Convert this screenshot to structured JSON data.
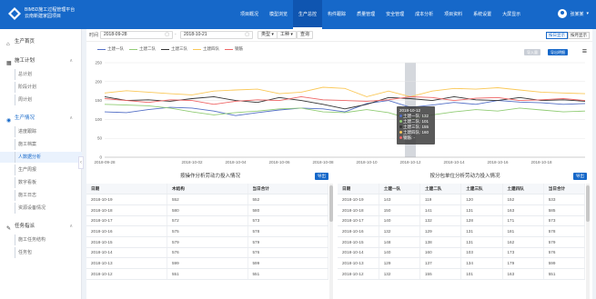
{
  "brand": {
    "line1": "BIM5D施工过程管理平台",
    "line2": "云南新建家园项目"
  },
  "nav": [
    {
      "label": "项目概况"
    },
    {
      "label": "模型浏览"
    },
    {
      "label": "生产总控",
      "active": true
    },
    {
      "label": "构件跟踪"
    },
    {
      "label": "质量管理"
    },
    {
      "label": "安全管理"
    },
    {
      "label": "成本分析"
    },
    {
      "label": "项目资料"
    },
    {
      "label": "系统设置"
    },
    {
      "label": "大屏显示"
    }
  ],
  "user": {
    "name": "张某某"
  },
  "sidebar": [
    {
      "label": "生产首页",
      "type": "main",
      "icon": "⌂",
      "iconName": "home-icon"
    },
    {
      "label": "施工计划",
      "type": "main",
      "icon": "▦",
      "iconName": "calendar-icon",
      "chev": "∧"
    },
    {
      "label": "总计划",
      "type": "sub"
    },
    {
      "label": "阶段计划",
      "type": "sub"
    },
    {
      "label": "周计划",
      "type": "sub"
    },
    {
      "label": "生产情况",
      "type": "main",
      "icon": "◉",
      "iconName": "production-icon",
      "chev": "∧",
      "blue": true
    },
    {
      "label": "进度跟踪",
      "type": "sub"
    },
    {
      "label": "施工档案",
      "type": "sub"
    },
    {
      "label": "人数据分析",
      "type": "sub",
      "active": true
    },
    {
      "label": "生产周报",
      "type": "sub"
    },
    {
      "label": "数字看板",
      "type": "sub"
    },
    {
      "label": "施工日志",
      "type": "sub"
    },
    {
      "label": "资源设备情况",
      "type": "sub"
    },
    {
      "label": "任务指派",
      "type": "main",
      "icon": "✎",
      "iconName": "task-icon",
      "chev": "∧"
    },
    {
      "label": "施工任务结构",
      "type": "sub"
    },
    {
      "label": "任务包",
      "type": "sub"
    }
  ],
  "filters": {
    "period_label": "时间",
    "start": "2018-09-28",
    "end": "2018-10-21",
    "type_select": "类型 ▾",
    "worker_select": "工种 ▾",
    "query": "查询",
    "toggle_a": "按日显示",
    "toggle_b": "按月显示"
  },
  "chart_data": {
    "type": "line",
    "x": [
      "2018-09-28",
      "2018-09-29",
      "2018-09-30",
      "2018-10-01",
      "2018-10-02",
      "2018-10-03",
      "2018-10-04",
      "2018-10-05",
      "2018-10-06",
      "2018-10-07",
      "2018-10-08",
      "2018-10-09",
      "2018-10-10",
      "2018-10-11",
      "2018-10-12",
      "2018-10-13",
      "2018-10-14",
      "2018-10-15",
      "2018-10-16",
      "2018-10-17",
      "2018-10-18",
      "2018-10-19",
      "2018-10-20"
    ],
    "xticks": [
      "2018-09-28",
      "2018-10-02",
      "2018-10-04",
      "2018-10-06",
      "2018-10-08",
      "2018-10-10",
      "2018-10-12",
      "2018-10-14",
      "2018-10-16",
      "2018-10-18"
    ],
    "yticks": [
      0,
      50,
      100,
      150,
      200,
      250
    ],
    "ylim": [
      0,
      250
    ],
    "series": [
      {
        "name": "土建一队",
        "color": "#5470c6",
        "values": [
          120,
          118,
          126,
          132,
          130,
          122,
          110,
          118,
          125,
          130,
          128,
          120,
          142,
          150,
          132,
          138,
          145,
          140,
          150,
          146,
          144,
          140,
          142
        ]
      },
      {
        "name": "土建二队",
        "color": "#91cc75",
        "values": [
          140,
          138,
          136,
          130,
          120,
          112,
          118,
          122,
          128,
          130,
          120,
          118,
          126,
          118,
          101,
          112,
          120,
          126,
          122,
          130,
          125,
          120,
          122
        ]
      },
      {
        "name": "土建三队",
        "color": "#333333",
        "values": [
          160,
          150,
          152,
          148,
          155,
          160,
          150,
          145,
          158,
          150,
          140,
          128,
          140,
          158,
          155,
          150,
          160,
          152,
          150,
          158,
          150,
          152,
          148
        ]
      },
      {
        "name": "土建四队",
        "color": "#fac858",
        "values": [
          170,
          176,
          172,
          168,
          165,
          175,
          178,
          180,
          168,
          172,
          185,
          182,
          160,
          175,
          160,
          175,
          182,
          180,
          184,
          178,
          172,
          170,
          168
        ]
      },
      {
        "name": "钢筋",
        "color": "#ee6666",
        "values": [
          155,
          150,
          145,
          152,
          150,
          140,
          148,
          152,
          150,
          160,
          152,
          150,
          148,
          152,
          160,
          158,
          150,
          156,
          158,
          150,
          152,
          155,
          150
        ]
      }
    ],
    "buttons": {
      "a": "导入量",
      "b": "导出明细"
    }
  },
  "tooltip": {
    "date": "2018-10-12",
    "rows": [
      {
        "label": "土建一队: 132",
        "color": "#5470c6"
      },
      {
        "label": "土建二队: 101",
        "color": "#91cc75"
      },
      {
        "label": "土建三队: 155",
        "color": "#333333"
      },
      {
        "label": "土建四队: 160",
        "color": "#fac858"
      },
      {
        "label": "钢筋: -",
        "color": "#ee6666"
      }
    ]
  },
  "left_table": {
    "title": "按操作分析劳动力投入情况",
    "export": "导出",
    "headers": [
      "日期",
      "木结构",
      "当日合计"
    ],
    "rows": [
      [
        "2018-10-19",
        "552",
        "552"
      ],
      [
        "2018-10-18",
        "580",
        "580"
      ],
      [
        "2018-10-17",
        "572",
        "573"
      ],
      [
        "2018-10-16",
        "575",
        "578"
      ],
      [
        "2018-10-15",
        "579",
        "579"
      ],
      [
        "2018-10-14",
        "576",
        "576"
      ],
      [
        "2018-10-13",
        "599",
        "599"
      ],
      [
        "2018-10-12",
        "551",
        "551"
      ]
    ]
  },
  "right_table": {
    "title": "按分包单位分析劳动力投入情况",
    "export": "导出",
    "headers": [
      "日期",
      "土建一队",
      "土建二队",
      "土建三队",
      "土建四队",
      "当日合计"
    ],
    "rows": [
      [
        "2018-10-19",
        "143",
        "119",
        "120",
        "152",
        "533"
      ],
      [
        "2018-10-18",
        "150",
        "141",
        "131",
        "163",
        "585"
      ],
      [
        "2018-10-17",
        "140",
        "132",
        "128",
        "171",
        "573"
      ],
      [
        "2018-10-16",
        "132",
        "129",
        "131",
        "181",
        "578"
      ],
      [
        "2018-10-15",
        "148",
        "138",
        "131",
        "162",
        "579"
      ],
      [
        "2018-10-14",
        "140",
        "160",
        "103",
        "173",
        "576"
      ],
      [
        "2018-10-13",
        "129",
        "137",
        "134",
        "179",
        "599"
      ],
      [
        "2018-10-12",
        "132",
        "155",
        "101",
        "163",
        "551"
      ]
    ]
  }
}
